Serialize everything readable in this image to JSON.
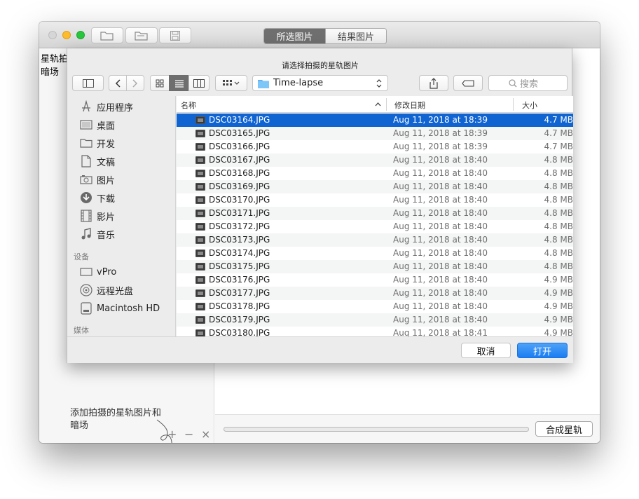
{
  "toolbar": {
    "tabs": [
      {
        "label": "所选图片",
        "active": true
      },
      {
        "label": "结果图片",
        "active": false
      }
    ]
  },
  "left_pane": {
    "items": [
      "星轨拍",
      "暗场"
    ],
    "hint": "添加拍摄的星轨图片和暗场",
    "add_symbol": "+",
    "remove_symbol": "−",
    "clear_symbol": "×"
  },
  "bottom": {
    "compose_label": "合成星轨",
    "progress": 0
  },
  "sheet": {
    "title": "请选择拍摄的星轨图片",
    "location": "Time-lapse",
    "search_placeholder": "搜索",
    "sidebar": {
      "favorites": [
        {
          "label": "应用程序",
          "icon": "applications-icon"
        },
        {
          "label": "桌面",
          "icon": "desktop-icon"
        },
        {
          "label": "开发",
          "icon": "folder-icon"
        },
        {
          "label": "文稿",
          "icon": "documents-icon"
        },
        {
          "label": "图片",
          "icon": "pictures-icon"
        },
        {
          "label": "下载",
          "icon": "downloads-icon"
        },
        {
          "label": "影片",
          "icon": "movies-icon"
        },
        {
          "label": "音乐",
          "icon": "music-icon"
        }
      ],
      "devices_header": "设备",
      "devices": [
        {
          "label": "vPro",
          "icon": "computer-icon"
        },
        {
          "label": "远程光盘",
          "icon": "remote-disc-icon"
        },
        {
          "label": "Macintosh HD",
          "icon": "hard-drive-icon"
        }
      ],
      "media_header": "媒体"
    },
    "columns": {
      "name": "名称",
      "date": "修改日期",
      "size": "大小"
    },
    "files": [
      {
        "name": "DSC03164.JPG",
        "date": "Aug 11, 2018 at 18:39",
        "size": "4.7 MB",
        "selected": true
      },
      {
        "name": "DSC03165.JPG",
        "date": "Aug 11, 2018 at 18:39",
        "size": "4.7 MB"
      },
      {
        "name": "DSC03166.JPG",
        "date": "Aug 11, 2018 at 18:39",
        "size": "4.7 MB"
      },
      {
        "name": "DSC03167.JPG",
        "date": "Aug 11, 2018 at 18:40",
        "size": "4.8 MB"
      },
      {
        "name": "DSC03168.JPG",
        "date": "Aug 11, 2018 at 18:40",
        "size": "4.8 MB"
      },
      {
        "name": "DSC03169.JPG",
        "date": "Aug 11, 2018 at 18:40",
        "size": "4.8 MB"
      },
      {
        "name": "DSC03170.JPG",
        "date": "Aug 11, 2018 at 18:40",
        "size": "4.8 MB"
      },
      {
        "name": "DSC03171.JPG",
        "date": "Aug 11, 2018 at 18:40",
        "size": "4.8 MB"
      },
      {
        "name": "DSC03172.JPG",
        "date": "Aug 11, 2018 at 18:40",
        "size": "4.8 MB"
      },
      {
        "name": "DSC03173.JPG",
        "date": "Aug 11, 2018 at 18:40",
        "size": "4.8 MB"
      },
      {
        "name": "DSC03174.JPG",
        "date": "Aug 11, 2018 at 18:40",
        "size": "4.8 MB"
      },
      {
        "name": "DSC03175.JPG",
        "date": "Aug 11, 2018 at 18:40",
        "size": "4.8 MB"
      },
      {
        "name": "DSC03176.JPG",
        "date": "Aug 11, 2018 at 18:40",
        "size": "4.9 MB"
      },
      {
        "name": "DSC03177.JPG",
        "date": "Aug 11, 2018 at 18:40",
        "size": "4.9 MB"
      },
      {
        "name": "DSC03178.JPG",
        "date": "Aug 11, 2018 at 18:40",
        "size": "4.9 MB"
      },
      {
        "name": "DSC03179.JPG",
        "date": "Aug 11, 2018 at 18:40",
        "size": "4.9 MB"
      },
      {
        "name": "DSC03180.JPG",
        "date": "Aug 11, 2018 at 18:41",
        "size": "4.9 MB"
      }
    ],
    "cancel_label": "取消",
    "open_label": "打开"
  },
  "colors": {
    "accent": "#0f64d2",
    "open_button": "#1b7cf2",
    "close": "#d4d4d4",
    "minimize": "#fdbb2e",
    "zoom": "#28c63f"
  }
}
